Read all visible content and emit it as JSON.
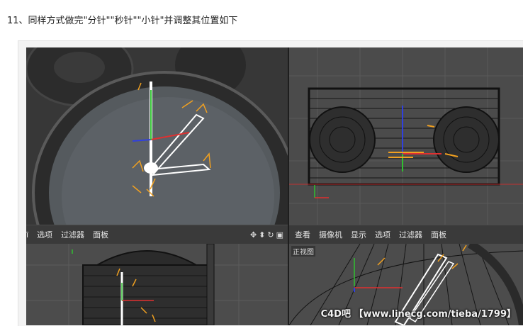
{
  "instruction": "11、同样方式做完\"分针\"\"秒针\"\"小针\"并调整其位置如下",
  "left_toolbar": {
    "partial": "ī",
    "items": [
      "选项",
      "过滤器",
      "面板"
    ],
    "icons": [
      "move-icon",
      "drag-icon",
      "rotate-icon",
      "layout-icon"
    ]
  },
  "right_toolbar": {
    "items": [
      "查看",
      "摄像机",
      "显示",
      "选项",
      "过滤器",
      "面板"
    ]
  },
  "front_view_label": "正视图",
  "watermark": "C4D吧 【www.linecg.com/tieba/1799】",
  "colors": {
    "axis_x": "#e03030",
    "axis_y": "#30c030",
    "axis_z": "#3040e0",
    "handle": "#f0a020",
    "viewport": "#4a4a4a"
  }
}
